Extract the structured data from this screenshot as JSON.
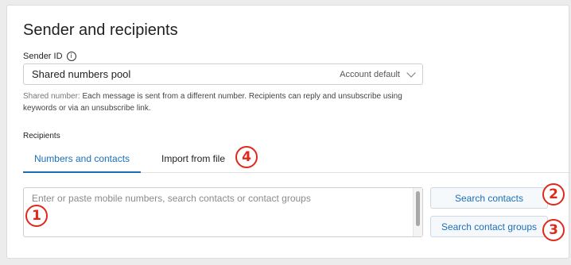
{
  "section": {
    "title": "Sender and recipients"
  },
  "sender": {
    "label": "Sender ID",
    "info_icon": "info-circle-icon",
    "selected_value": "Shared numbers pool",
    "default_badge": "Account default",
    "help_term": "Shared number:",
    "help_text": " Each message is sent from a different number. Recipients can reply and unsubscribe using keywords or via an unsubscribe link."
  },
  "recipients": {
    "label": "Recipients",
    "tabs": [
      {
        "label": "Numbers and contacts",
        "active": true
      },
      {
        "label": "Import from file",
        "active": false
      }
    ],
    "input_placeholder": "Enter or paste mobile numbers, search contacts or contact groups",
    "search_contacts_label": "Search contacts",
    "search_groups_label": "Search contact groups"
  },
  "markers": [
    "1",
    "2",
    "3",
    "4"
  ],
  "colors": {
    "accent": "#1b6fb8",
    "marker": "#e0291c"
  }
}
